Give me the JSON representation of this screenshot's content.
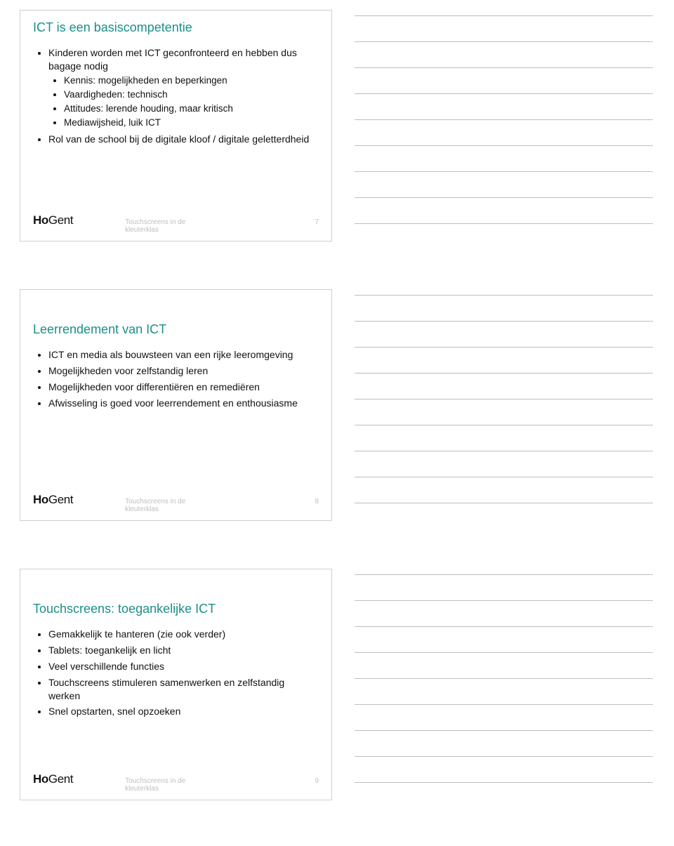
{
  "footer_text": "Touchscreens in de kleuterklas",
  "logo_bold": "Ho",
  "logo_rest": "Gent",
  "slides": [
    {
      "title": "ICT is een basiscompetentie",
      "page": "7",
      "items": [
        {
          "text": "Kinderen worden met ICT geconfronteerd en hebben dus bagage nodig",
          "sub": [
            "Kennis: mogelijkheden en beperkingen",
            "Vaardigheden: technisch",
            "Attitudes: lerende houding, maar kritisch",
            "Mediawijsheid, luik ICT"
          ]
        },
        {
          "text": "Rol van de school bij de digitale kloof / digitale geletterdheid",
          "sub": []
        }
      ]
    },
    {
      "title": "Leerrendement van ICT",
      "page": "8",
      "items": [
        {
          "text": "ICT en media als bouwsteen van een rijke leeromgeving",
          "sub": []
        },
        {
          "text": "Mogelijkheden voor zelfstandig leren",
          "sub": []
        },
        {
          "text": "Mogelijkheden voor differentiëren en remediëren",
          "sub": []
        },
        {
          "text": "Afwisseling is goed voor leerrendement en enthousiasme",
          "sub": []
        }
      ]
    },
    {
      "title": "Touchscreens: toegankelijke ICT",
      "page": "9",
      "items": [
        {
          "text": "Gemakkelijk te hanteren (zie ook verder)",
          "sub": []
        },
        {
          "text": "Tablets: toegankelijk en licht",
          "sub": []
        },
        {
          "text": "Veel verschillende functies",
          "sub": []
        },
        {
          "text": "Touchscreens stimuleren samenwerken en zelfstandig werken",
          "sub": []
        },
        {
          "text": "Snel opstarten, snel opzoeken",
          "sub": []
        }
      ]
    }
  ]
}
